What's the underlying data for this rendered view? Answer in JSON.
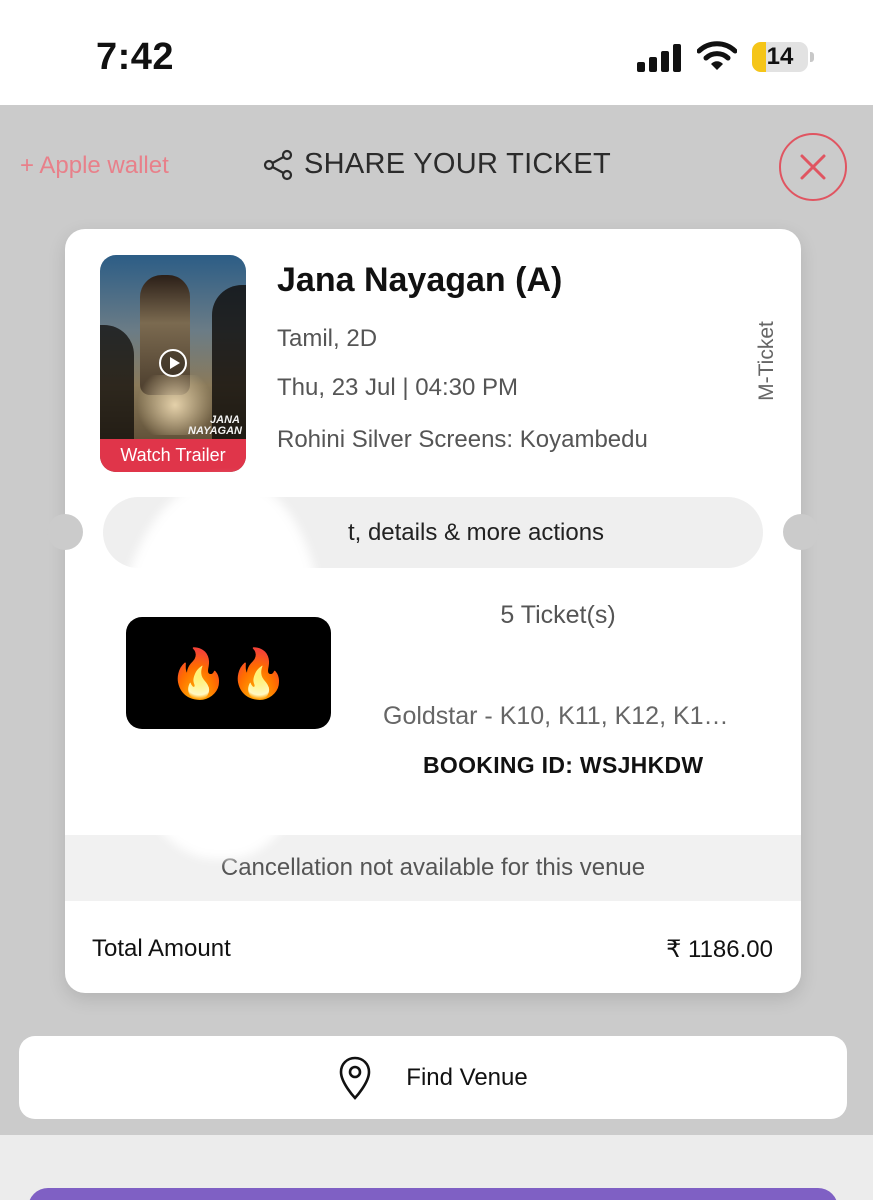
{
  "status_bar": {
    "time": "7:42",
    "battery": "14"
  },
  "header": {
    "apple_wallet": "+ Apple wallet",
    "share_label": "SHARE YOUR TICKET"
  },
  "ticket": {
    "title": "Jana Nayagan (A)",
    "language_format": "Tamil, 2D",
    "date_time": "Thu, 23 Jul | 04:30 PM",
    "venue": "Rohini Silver Screens: Koyambedu",
    "poster_title": "JANA NAYAGAN",
    "watch_trailer": "Watch Trailer",
    "m_ticket": "M-Ticket",
    "details_pill": "t, details & more actions",
    "emoji": "🔥🔥",
    "ticket_count": "5 Ticket(s)",
    "seats": "Goldstar - K10, K11, K12, K1…",
    "booking_id": "BOOKING ID: WSJHKDW",
    "cancellation": "Cancellation not available for this venue",
    "total_label": "Total Amount",
    "total_amount": "₹ 1186.00"
  },
  "find_venue": {
    "label": "Find Venue"
  },
  "colors": {
    "accent_red": "#e0354a",
    "close_red": "#e05561",
    "wallet_pink": "#e8808a",
    "cta_purple": "#7f60c4"
  }
}
